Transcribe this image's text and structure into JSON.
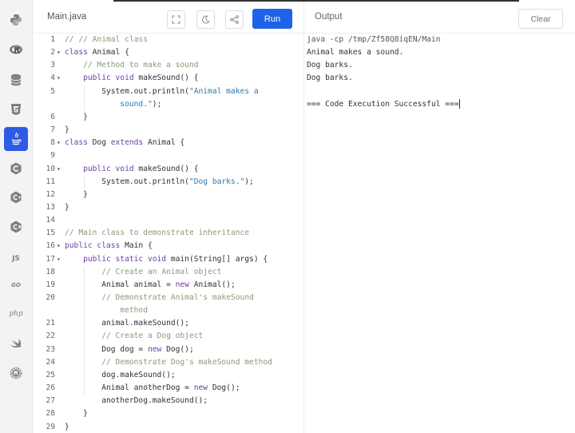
{
  "editor": {
    "filename": "Main.java",
    "run_label": "Run",
    "lines": [
      {
        "n": "1",
        "fold": false,
        "seg": [
          {
            "c": "cm",
            "t": "// // Animal class"
          }
        ]
      },
      {
        "n": "2",
        "fold": true,
        "seg": [
          {
            "c": "kw",
            "t": "class "
          },
          {
            "c": "tx",
            "t": "Animal {"
          }
        ]
      },
      {
        "n": "3",
        "fold": false,
        "seg": [
          {
            "c": "cm",
            "t": "    // Method to make a sound"
          }
        ]
      },
      {
        "n": "4",
        "fold": true,
        "seg": [
          {
            "c": "kw",
            "t": "    public void "
          },
          {
            "c": "tx",
            "t": "makeSound() {"
          }
        ]
      },
      {
        "n": "5",
        "fold": false,
        "seg": [
          {
            "c": "tx",
            "t": "        System.out.println("
          },
          {
            "c": "st",
            "t": "\"Animal makes a"
          }
        ]
      },
      {
        "n": "",
        "fold": false,
        "seg": [
          {
            "c": "st",
            "t": "            sound.\""
          },
          {
            "c": "tx",
            "t": ");"
          }
        ]
      },
      {
        "n": "6",
        "fold": false,
        "seg": [
          {
            "c": "tx",
            "t": "    }"
          }
        ]
      },
      {
        "n": "7",
        "fold": false,
        "seg": [
          {
            "c": "tx",
            "t": "}"
          }
        ]
      },
      {
        "n": "8",
        "fold": true,
        "seg": [
          {
            "c": "kw",
            "t": "class "
          },
          {
            "c": "tx",
            "t": "Dog "
          },
          {
            "c": "kw",
            "t": "extends "
          },
          {
            "c": "tx",
            "t": "Animal {"
          }
        ]
      },
      {
        "n": "9",
        "fold": false,
        "seg": []
      },
      {
        "n": "10",
        "fold": true,
        "seg": [
          {
            "c": "kw",
            "t": "    public void "
          },
          {
            "c": "tx",
            "t": "makeSound() {"
          }
        ]
      },
      {
        "n": "11",
        "fold": false,
        "seg": [
          {
            "c": "tx",
            "t": "        System.out.println("
          },
          {
            "c": "st",
            "t": "\"Dog barks.\""
          },
          {
            "c": "tx",
            "t": ");"
          }
        ]
      },
      {
        "n": "12",
        "fold": false,
        "seg": [
          {
            "c": "tx",
            "t": "    }"
          }
        ]
      },
      {
        "n": "13",
        "fold": false,
        "seg": [
          {
            "c": "tx",
            "t": "}"
          }
        ]
      },
      {
        "n": "14",
        "fold": false,
        "seg": []
      },
      {
        "n": "15",
        "fold": false,
        "seg": [
          {
            "c": "cm",
            "t": "// Main class to demonstrate inheritance"
          }
        ]
      },
      {
        "n": "16",
        "fold": true,
        "seg": [
          {
            "c": "kw",
            "t": "public class "
          },
          {
            "c": "tx",
            "t": "Main {"
          }
        ]
      },
      {
        "n": "17",
        "fold": true,
        "seg": [
          {
            "c": "kw",
            "t": "    public static void "
          },
          {
            "c": "tx",
            "t": "main(String[] args) {"
          }
        ]
      },
      {
        "n": "18",
        "fold": false,
        "seg": [
          {
            "c": "cm",
            "t": "        // Create an Animal object"
          }
        ]
      },
      {
        "n": "19",
        "fold": false,
        "seg": [
          {
            "c": "tx",
            "t": "        Animal animal = "
          },
          {
            "c": "kw",
            "t": "new "
          },
          {
            "c": "tx",
            "t": "Animal();"
          }
        ]
      },
      {
        "n": "20",
        "fold": false,
        "seg": [
          {
            "c": "cm",
            "t": "        // Demonstrate Animal's makeSound"
          }
        ]
      },
      {
        "n": "",
        "fold": false,
        "seg": [
          {
            "c": "cm",
            "t": "            method"
          }
        ]
      },
      {
        "n": "21",
        "fold": false,
        "seg": [
          {
            "c": "tx",
            "t": "        animal.makeSound();"
          }
        ]
      },
      {
        "n": "22",
        "fold": false,
        "seg": [
          {
            "c": "cm",
            "t": "        // Create a Dog object"
          }
        ]
      },
      {
        "n": "23",
        "fold": false,
        "seg": [
          {
            "c": "tx",
            "t": "        Dog dog = "
          },
          {
            "c": "kw",
            "t": "new "
          },
          {
            "c": "tx",
            "t": "Dog();"
          }
        ]
      },
      {
        "n": "24",
        "fold": false,
        "seg": [
          {
            "c": "cm",
            "t": "        // Demonstrate Dog's makeSound method"
          }
        ]
      },
      {
        "n": "25",
        "fold": false,
        "seg": [
          {
            "c": "tx",
            "t": "        dog.makeSound();"
          }
        ]
      },
      {
        "n": "26",
        "fold": false,
        "seg": [
          {
            "c": "tx",
            "t": "        Animal anotherDog = "
          },
          {
            "c": "kw",
            "t": "new "
          },
          {
            "c": "tx",
            "t": "Dog();"
          }
        ]
      },
      {
        "n": "27",
        "fold": false,
        "seg": [
          {
            "c": "tx",
            "t": "        anotherDog.makeSound();"
          }
        ]
      },
      {
        "n": "28",
        "fold": false,
        "seg": [
          {
            "c": "tx",
            "t": "    }"
          }
        ]
      },
      {
        "n": "29",
        "fold": false,
        "seg": [
          {
            "c": "tx",
            "t": "}"
          }
        ]
      }
    ]
  },
  "output": {
    "title": "Output",
    "clear_label": "Clear",
    "lines": [
      "java -cp /tmp/Zf58Q8iqEN/Main",
      "Animal makes a sound.",
      "Dog barks.",
      "Dog barks.",
      "",
      "=== Code Execution Successful ==="
    ]
  },
  "sidebar": {
    "items": [
      {
        "name": "python-icon",
        "active": false
      },
      {
        "name": "r-icon",
        "active": false
      },
      {
        "name": "sql-icon",
        "active": false
      },
      {
        "name": "html-icon",
        "active": false
      },
      {
        "name": "java-icon",
        "active": true
      },
      {
        "name": "c-icon",
        "active": false
      },
      {
        "name": "cpp-icon",
        "active": false
      },
      {
        "name": "csharp-icon",
        "active": false
      },
      {
        "name": "js-icon",
        "active": false,
        "text": "JS"
      },
      {
        "name": "go-icon",
        "active": false,
        "text": "GO"
      },
      {
        "name": "php-icon",
        "active": false,
        "text": "php"
      },
      {
        "name": "swift-icon",
        "active": false
      },
      {
        "name": "rust-icon",
        "active": false
      }
    ]
  },
  "colors": {
    "accent": "#1e62e8",
    "active_sidebar": "#2d5be4",
    "comment": "#8b9a76",
    "keyword": "#6a3fa0",
    "string": "#2a7bb0"
  }
}
